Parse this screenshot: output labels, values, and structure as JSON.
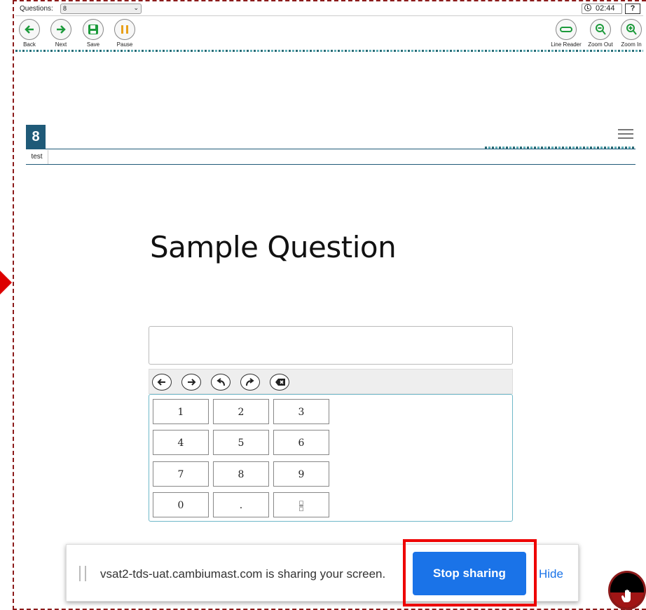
{
  "topbar": {
    "questions_label": "Questions:",
    "questions_value": "8",
    "timer": "02:44",
    "help": "?"
  },
  "toolbar": {
    "left": [
      {
        "label": "Back",
        "icon": "arrow-left-icon"
      },
      {
        "label": "Next",
        "icon": "arrow-right-icon"
      },
      {
        "label": "Save",
        "icon": "save-icon"
      },
      {
        "label": "Pause",
        "icon": "pause-icon"
      }
    ],
    "right": [
      {
        "label": "Line Reader",
        "icon": "line-reader-icon"
      },
      {
        "label": "Zoom Out",
        "icon": "zoom-out-icon"
      },
      {
        "label": "Zoom In",
        "icon": "zoom-in-icon"
      }
    ]
  },
  "question": {
    "number": "8",
    "tag": "test",
    "title": "Sample Question",
    "answer_value": ""
  },
  "keypad": {
    "tools": [
      "move-left-icon",
      "move-right-icon",
      "undo-icon",
      "redo-icon",
      "backspace-icon"
    ],
    "keys": [
      "1",
      "2",
      "3",
      "4",
      "5",
      "6",
      "7",
      "8",
      "9",
      "0",
      ".",
      "fraction"
    ]
  },
  "share_bar": {
    "message": "vsat2-tds-uat.cambiumast.com is sharing your screen.",
    "stop_label": "Stop sharing",
    "hide_label": "Hide"
  },
  "colors": {
    "accent": "#1f5a78",
    "share_button": "#1a73e8",
    "highlight": "#ee0000",
    "frame": "#8b1a1a"
  }
}
